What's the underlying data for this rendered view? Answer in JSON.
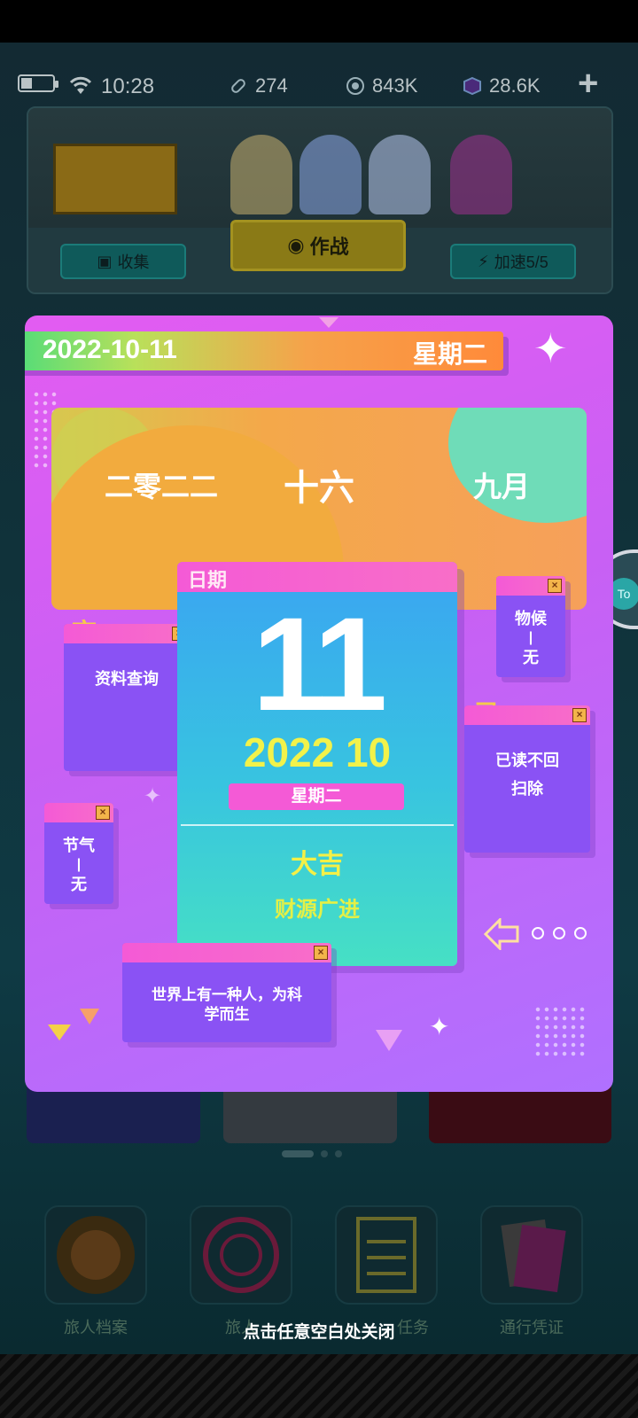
{
  "status_bar": {
    "time": "10:28",
    "resource_1": "274",
    "resource_2": "843K",
    "resource_3": "28.6K",
    "add_label": "+"
  },
  "top_panel": {
    "collect_label": "收集",
    "battle_label": "作战",
    "speed_label": "加速5/5"
  },
  "calendar": {
    "date": "2022-10-11",
    "weekday": "星期二",
    "lunar_year": "二零二二",
    "lunar_day": "十六",
    "lunar_month": "九月",
    "card_header": "日期",
    "day": "11",
    "year_month": "2022 10",
    "card_weekday": "星期二",
    "luck": "大吉",
    "fortune": "财源广进",
    "suitable_label": "宜",
    "suitable_text": "资料查询",
    "avoid_label": "忌",
    "avoid_text_1": "已读不回",
    "avoid_text_2": "扫除",
    "phenology_title": "物候",
    "phenology_value": "无",
    "solar_term_title": "节气",
    "solar_term_value": "无",
    "quote": "世界上有一种人，为科学而生"
  },
  "bottom_nav": [
    {
      "label": "旅人档案"
    },
    {
      "label": "旅人"
    },
    {
      "label": "任务"
    },
    {
      "label": "通行凭证"
    }
  ],
  "close_hint": "点击任意空白处关闭",
  "side_button": "To",
  "colors": {
    "popup_pink": "#e35cf2",
    "card_blue": "#3aa4f2",
    "yellow_text": "#f2f24a",
    "mini_window": "#8a52f4"
  }
}
